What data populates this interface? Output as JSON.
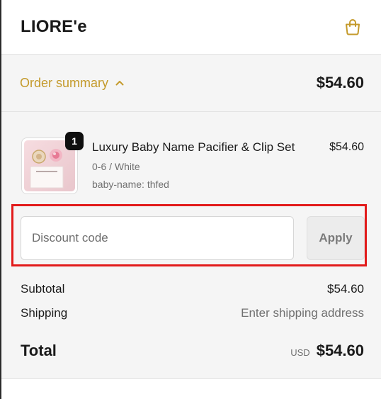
{
  "header": {
    "brand": "LIORE'e",
    "cart_icon": "shopping-bag-icon"
  },
  "summary_toggle": {
    "label": "Order summary",
    "chevron_icon": "chevron-up-icon",
    "total": "$54.60"
  },
  "line_item": {
    "quantity": "1",
    "title": "Luxury Baby Name Pacifier & Clip Set",
    "variant": "0-6 / White",
    "property": "baby-name: thfed",
    "price": "$54.60"
  },
  "discount": {
    "placeholder": "Discount code",
    "value": "",
    "apply_label": "Apply"
  },
  "totals": {
    "subtotal_label": "Subtotal",
    "subtotal_value": "$54.60",
    "shipping_label": "Shipping",
    "shipping_value": "Enter shipping address",
    "total_label": "Total",
    "currency": "USD",
    "total_value": "$54.60"
  },
  "colors": {
    "accent": "#c49a2b",
    "highlight": "#e21b1b"
  }
}
